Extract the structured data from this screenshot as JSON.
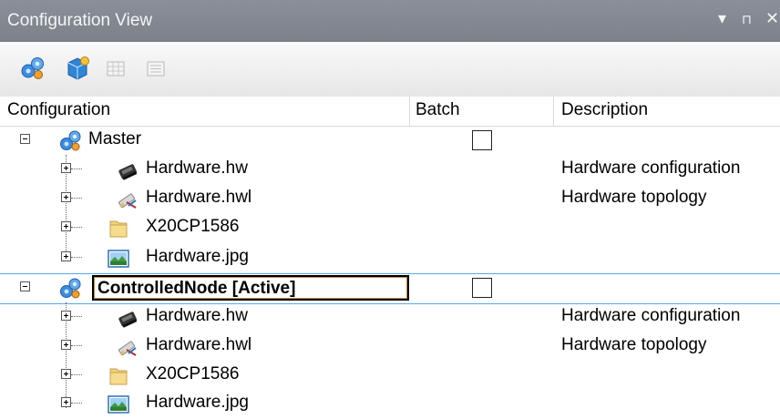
{
  "panel": {
    "title": "Configuration View",
    "controls": {
      "dropdown": "▾",
      "pin": "⊓",
      "close": "✕"
    }
  },
  "toolbar": {
    "buttons": [
      "add-configuration-icon",
      "add-object-icon",
      "grid-view-icon",
      "list-view-icon"
    ]
  },
  "columns": {
    "configuration": "Configuration",
    "batch": "Batch",
    "description": "Description"
  },
  "tree": {
    "master": {
      "label": "Master",
      "batch_checked": false,
      "children": [
        {
          "label": "Hardware.hw",
          "icon": "hardware-chip-icon",
          "description": "Hardware configuration"
        },
        {
          "label": "Hardware.hwl",
          "icon": "topology-pencil-icon",
          "description": "Hardware topology"
        },
        {
          "label": "X20CP1586",
          "icon": "folder-icon",
          "description": ""
        },
        {
          "label": "Hardware.jpg",
          "icon": "image-file-icon",
          "description": ""
        }
      ]
    },
    "controlled": {
      "label": "ControlledNode [Active]",
      "batch_checked": false,
      "children": [
        {
          "label": "Hardware.hw",
          "icon": "hardware-chip-icon",
          "description": "Hardware configuration"
        },
        {
          "label": "Hardware.hwl",
          "icon": "topology-pencil-icon",
          "description": "Hardware topology"
        },
        {
          "label": "X20CP1586",
          "icon": "folder-icon",
          "description": ""
        },
        {
          "label": "Hardware.jpg",
          "icon": "image-file-icon",
          "description": ""
        }
      ]
    }
  },
  "colors": {
    "titlebar": "#7c818a",
    "selection_line": "#5aa9e6",
    "config_icon": "#2e7fd1"
  }
}
